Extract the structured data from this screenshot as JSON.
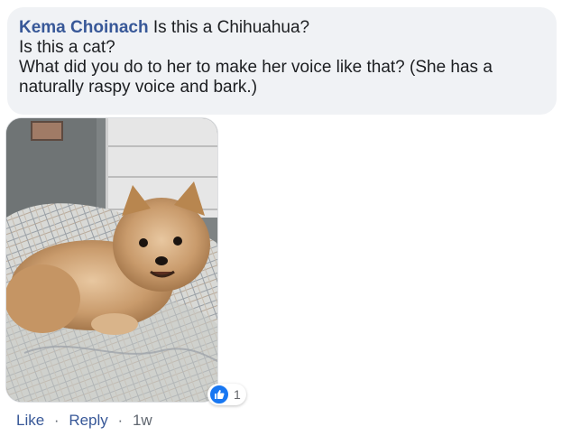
{
  "comment": {
    "author": "Kema Choinach",
    "lines": [
      "Is this a Chihuahua?",
      "Is this a cat?",
      "What did you do to her to make her voice like that? (She has a",
      "naturally raspy voice and bark.)"
    ]
  },
  "reactions": {
    "icon": "thumbs-up-icon",
    "count": "1",
    "color": "#1877f2"
  },
  "actions": {
    "like": "Like",
    "reply": "Reply",
    "separator": "·",
    "timestamp": "1w"
  },
  "colors": {
    "bubble": "#f0f2f5",
    "author": "#385898",
    "link": "#385898"
  }
}
